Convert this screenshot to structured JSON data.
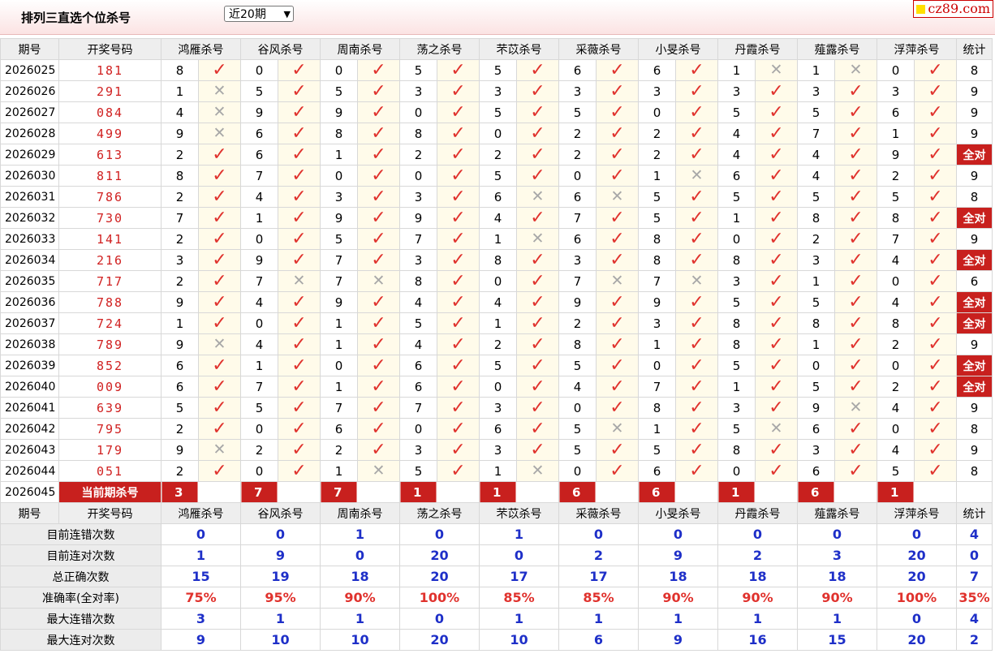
{
  "header": {
    "title": "排列三直选个位杀号",
    "period_select": "近20期",
    "logo": "cz89.com"
  },
  "columns": [
    "期号",
    "开奖号码",
    "鸿雁杀号",
    "谷风杀号",
    "周南杀号",
    "荡之杀号",
    "芣苡杀号",
    "采薇杀号",
    "小旻杀号",
    "丹霞杀号",
    "薤露杀号",
    "浮萍杀号",
    "统计"
  ],
  "rows": [
    {
      "id": "2026025",
      "num": "181",
      "p": [
        [
          8,
          1
        ],
        [
          0,
          1
        ],
        [
          0,
          1
        ],
        [
          5,
          1
        ],
        [
          5,
          1
        ],
        [
          6,
          1
        ],
        [
          6,
          1
        ],
        [
          1,
          0
        ],
        [
          1,
          0
        ],
        [
          0,
          1
        ]
      ],
      "stat": "8"
    },
    {
      "id": "2026026",
      "num": "291",
      "p": [
        [
          1,
          0
        ],
        [
          5,
          1
        ],
        [
          5,
          1
        ],
        [
          3,
          1
        ],
        [
          3,
          1
        ],
        [
          3,
          1
        ],
        [
          3,
          1
        ],
        [
          3,
          1
        ],
        [
          3,
          1
        ],
        [
          3,
          1
        ]
      ],
      "stat": "9"
    },
    {
      "id": "2026027",
      "num": "084",
      "p": [
        [
          4,
          0
        ],
        [
          9,
          1
        ],
        [
          9,
          1
        ],
        [
          0,
          1
        ],
        [
          5,
          1
        ],
        [
          5,
          1
        ],
        [
          0,
          1
        ],
        [
          5,
          1
        ],
        [
          5,
          1
        ],
        [
          6,
          1
        ]
      ],
      "stat": "9"
    },
    {
      "id": "2026028",
      "num": "499",
      "p": [
        [
          9,
          0
        ],
        [
          6,
          1
        ],
        [
          8,
          1
        ],
        [
          8,
          1
        ],
        [
          0,
          1
        ],
        [
          2,
          1
        ],
        [
          2,
          1
        ],
        [
          4,
          1
        ],
        [
          7,
          1
        ],
        [
          1,
          1
        ]
      ],
      "stat": "9"
    },
    {
      "id": "2026029",
      "num": "613",
      "p": [
        [
          2,
          1
        ],
        [
          6,
          1
        ],
        [
          1,
          1
        ],
        [
          2,
          1
        ],
        [
          2,
          1
        ],
        [
          2,
          1
        ],
        [
          2,
          1
        ],
        [
          4,
          1
        ],
        [
          4,
          1
        ],
        [
          9,
          1
        ]
      ],
      "stat": "全对"
    },
    {
      "id": "2026030",
      "num": "811",
      "p": [
        [
          8,
          1
        ],
        [
          7,
          1
        ],
        [
          0,
          1
        ],
        [
          0,
          1
        ],
        [
          5,
          1
        ],
        [
          0,
          1
        ],
        [
          1,
          0
        ],
        [
          6,
          1
        ],
        [
          4,
          1
        ],
        [
          2,
          1
        ]
      ],
      "stat": "9"
    },
    {
      "id": "2026031",
      "num": "786",
      "p": [
        [
          2,
          1
        ],
        [
          4,
          1
        ],
        [
          3,
          1
        ],
        [
          3,
          1
        ],
        [
          6,
          0
        ],
        [
          6,
          0
        ],
        [
          5,
          1
        ],
        [
          5,
          1
        ],
        [
          5,
          1
        ],
        [
          5,
          1
        ]
      ],
      "stat": "8"
    },
    {
      "id": "2026032",
      "num": "730",
      "p": [
        [
          7,
          1
        ],
        [
          1,
          1
        ],
        [
          9,
          1
        ],
        [
          9,
          1
        ],
        [
          4,
          1
        ],
        [
          7,
          1
        ],
        [
          5,
          1
        ],
        [
          1,
          1
        ],
        [
          8,
          1
        ],
        [
          8,
          1
        ]
      ],
      "stat": "全对"
    },
    {
      "id": "2026033",
      "num": "141",
      "p": [
        [
          2,
          1
        ],
        [
          0,
          1
        ],
        [
          5,
          1
        ],
        [
          7,
          1
        ],
        [
          1,
          0
        ],
        [
          6,
          1
        ],
        [
          8,
          1
        ],
        [
          0,
          1
        ],
        [
          2,
          1
        ],
        [
          7,
          1
        ]
      ],
      "stat": "9"
    },
    {
      "id": "2026034",
      "num": "216",
      "p": [
        [
          3,
          1
        ],
        [
          9,
          1
        ],
        [
          7,
          1
        ],
        [
          3,
          1
        ],
        [
          8,
          1
        ],
        [
          3,
          1
        ],
        [
          8,
          1
        ],
        [
          8,
          1
        ],
        [
          3,
          1
        ],
        [
          4,
          1
        ]
      ],
      "stat": "全对"
    },
    {
      "id": "2026035",
      "num": "717",
      "p": [
        [
          2,
          1
        ],
        [
          7,
          0
        ],
        [
          7,
          0
        ],
        [
          8,
          1
        ],
        [
          0,
          1
        ],
        [
          7,
          0
        ],
        [
          7,
          0
        ],
        [
          3,
          1
        ],
        [
          1,
          1
        ],
        [
          0,
          1
        ]
      ],
      "stat": "6"
    },
    {
      "id": "2026036",
      "num": "788",
      "p": [
        [
          9,
          1
        ],
        [
          4,
          1
        ],
        [
          9,
          1
        ],
        [
          4,
          1
        ],
        [
          4,
          1
        ],
        [
          9,
          1
        ],
        [
          9,
          1
        ],
        [
          5,
          1
        ],
        [
          5,
          1
        ],
        [
          4,
          1
        ]
      ],
      "stat": "全对"
    },
    {
      "id": "2026037",
      "num": "724",
      "p": [
        [
          1,
          1
        ],
        [
          0,
          1
        ],
        [
          1,
          1
        ],
        [
          5,
          1
        ],
        [
          1,
          1
        ],
        [
          2,
          1
        ],
        [
          3,
          1
        ],
        [
          8,
          1
        ],
        [
          8,
          1
        ],
        [
          8,
          1
        ]
      ],
      "stat": "全对"
    },
    {
      "id": "2026038",
      "num": "789",
      "p": [
        [
          9,
          0
        ],
        [
          4,
          1
        ],
        [
          1,
          1
        ],
        [
          4,
          1
        ],
        [
          2,
          1
        ],
        [
          8,
          1
        ],
        [
          1,
          1
        ],
        [
          8,
          1
        ],
        [
          1,
          1
        ],
        [
          2,
          1
        ]
      ],
      "stat": "9"
    },
    {
      "id": "2026039",
      "num": "852",
      "p": [
        [
          6,
          1
        ],
        [
          1,
          1
        ],
        [
          0,
          1
        ],
        [
          6,
          1
        ],
        [
          5,
          1
        ],
        [
          5,
          1
        ],
        [
          0,
          1
        ],
        [
          5,
          1
        ],
        [
          0,
          1
        ],
        [
          0,
          1
        ]
      ],
      "stat": "全对"
    },
    {
      "id": "2026040",
      "num": "009",
      "p": [
        [
          6,
          1
        ],
        [
          7,
          1
        ],
        [
          1,
          1
        ],
        [
          6,
          1
        ],
        [
          0,
          1
        ],
        [
          4,
          1
        ],
        [
          7,
          1
        ],
        [
          1,
          1
        ],
        [
          5,
          1
        ],
        [
          2,
          1
        ]
      ],
      "stat": "全对"
    },
    {
      "id": "2026041",
      "num": "639",
      "p": [
        [
          5,
          1
        ],
        [
          5,
          1
        ],
        [
          7,
          1
        ],
        [
          7,
          1
        ],
        [
          3,
          1
        ],
        [
          0,
          1
        ],
        [
          8,
          1
        ],
        [
          3,
          1
        ],
        [
          9,
          0
        ],
        [
          4,
          1
        ]
      ],
      "stat": "9"
    },
    {
      "id": "2026042",
      "num": "795",
      "p": [
        [
          2,
          1
        ],
        [
          0,
          1
        ],
        [
          6,
          1
        ],
        [
          0,
          1
        ],
        [
          6,
          1
        ],
        [
          5,
          0
        ],
        [
          1,
          1
        ],
        [
          5,
          0
        ],
        [
          6,
          1
        ],
        [
          0,
          1
        ]
      ],
      "stat": "8"
    },
    {
      "id": "2026043",
      "num": "179",
      "p": [
        [
          9,
          0
        ],
        [
          2,
          1
        ],
        [
          2,
          1
        ],
        [
          3,
          1
        ],
        [
          3,
          1
        ],
        [
          5,
          1
        ],
        [
          5,
          1
        ],
        [
          8,
          1
        ],
        [
          3,
          1
        ],
        [
          4,
          1
        ]
      ],
      "stat": "9"
    },
    {
      "id": "2026044",
      "num": "051",
      "p": [
        [
          2,
          1
        ],
        [
          0,
          1
        ],
        [
          1,
          0
        ],
        [
          5,
          1
        ],
        [
          1,
          0
        ],
        [
          0,
          1
        ],
        [
          6,
          1
        ],
        [
          0,
          1
        ],
        [
          6,
          1
        ],
        [
          5,
          1
        ]
      ],
      "stat": "8"
    }
  ],
  "current": {
    "id": "2026045",
    "label": "当前期杀号",
    "kills": [
      "3",
      "7",
      "7",
      "1",
      "1",
      "6",
      "6",
      "1",
      "6",
      "1"
    ]
  },
  "stats": [
    {
      "label": "目前连错次数",
      "vals": [
        "0",
        "0",
        "1",
        "0",
        "1",
        "0",
        "0",
        "0",
        "0",
        "0",
        "4"
      ],
      "red": false
    },
    {
      "label": "目前连对次数",
      "vals": [
        "1",
        "9",
        "0",
        "20",
        "0",
        "2",
        "9",
        "2",
        "3",
        "20",
        "0"
      ],
      "red": false
    },
    {
      "label": "总正确次数",
      "vals": [
        "15",
        "19",
        "18",
        "20",
        "17",
        "17",
        "18",
        "18",
        "18",
        "20",
        "7"
      ],
      "red": false
    },
    {
      "label": "准确率(全对率)",
      "vals": [
        "75%",
        "95%",
        "90%",
        "100%",
        "85%",
        "85%",
        "90%",
        "90%",
        "90%",
        "100%",
        "35%"
      ],
      "red": true
    },
    {
      "label": "最大连错次数",
      "vals": [
        "3",
        "1",
        "1",
        "0",
        "1",
        "1",
        "1",
        "1",
        "1",
        "0",
        "4"
      ],
      "red": false
    },
    {
      "label": "最大连对次数",
      "vals": [
        "9",
        "10",
        "10",
        "20",
        "10",
        "6",
        "9",
        "16",
        "15",
        "20",
        "2"
      ],
      "red": false
    }
  ],
  "icons": {
    "right": "check-icon",
    "wrong": "cross-icon"
  },
  "glyphs": {
    "right": "✓",
    "wrong": "✕"
  }
}
